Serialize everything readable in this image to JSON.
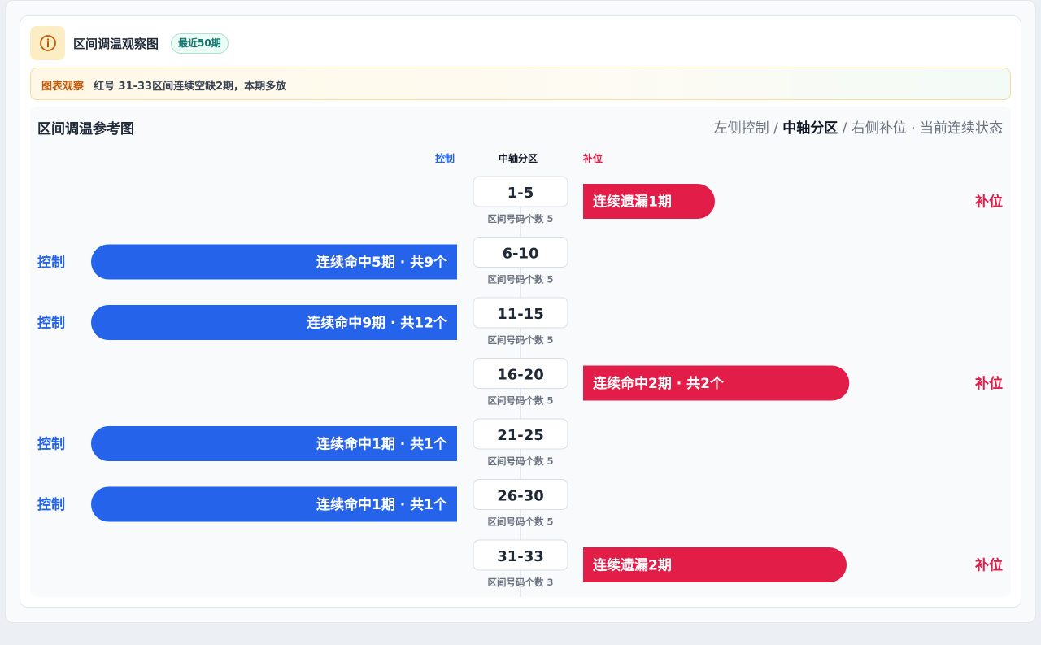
{
  "header": {
    "title": "区间调温观察图",
    "badge": "最近50期",
    "icon": "info-icon"
  },
  "observation": {
    "label": "图表观察",
    "text": "红号 31-33区间连续空缺2期，本期多放"
  },
  "panel": {
    "title": "区间调温参考图",
    "legend_left": "左侧控制",
    "legend_sep1": " / ",
    "legend_mid": "中轴分区",
    "legend_sep2": " / ",
    "legend_right": "右侧补位",
    "legend_dot": " · ",
    "legend_state": "当前连续状态"
  },
  "columns": {
    "left": "控制",
    "center": "中轴分区",
    "right": "补位"
  },
  "colors": {
    "control": "#2563eb",
    "fill": "#e11d48",
    "axis": "#cbd5e1"
  },
  "chart_data": {
    "type": "bar",
    "layout": "diverging",
    "rows": [
      {
        "zone": "1-5",
        "count_label": "区间号码个数 5",
        "side": "right",
        "side_label": "补位",
        "bar_label": "连续遗漏1期",
        "streak": 1
      },
      {
        "zone": "6-10",
        "count_label": "区间号码个数 5",
        "side": "left",
        "side_label": "控制",
        "bar_label": "连续命中5期 · 共9个",
        "streak": 5
      },
      {
        "zone": "11-15",
        "count_label": "区间号码个数 5",
        "side": "left",
        "side_label": "控制",
        "bar_label": "连续命中9期 · 共12个",
        "streak": 9
      },
      {
        "zone": "16-20",
        "count_label": "区间号码个数 5",
        "side": "right",
        "side_label": "补位",
        "bar_label": "连续命中2期 · 共2个",
        "streak": 2
      },
      {
        "zone": "21-25",
        "count_label": "区间号码个数 5",
        "side": "left",
        "side_label": "控制",
        "bar_label": "连续命中1期 · 共1个",
        "streak": 1
      },
      {
        "zone": "26-30",
        "count_label": "区间号码个数 5",
        "side": "left",
        "side_label": "控制",
        "bar_label": "连续命中1期 · 共1个",
        "streak": 1
      },
      {
        "zone": "31-33",
        "count_label": "区间号码个数 3",
        "side": "right",
        "side_label": "补位",
        "bar_label": "连续遗漏2期",
        "streak": 2
      }
    ]
  }
}
